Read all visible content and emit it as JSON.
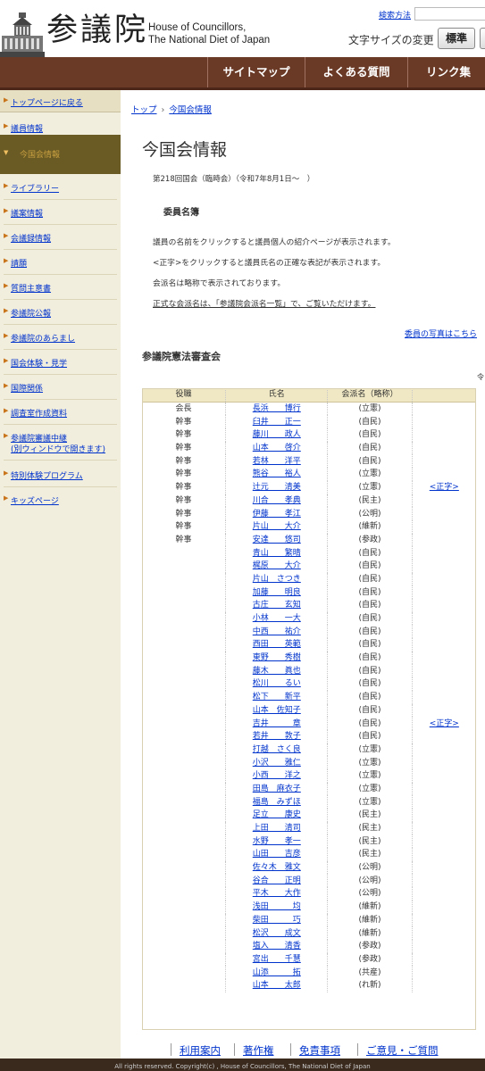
{
  "header": {
    "logo_text": "参議院",
    "name_en_1": "House of Councillors,",
    "name_en_2": "The National Diet of Japan",
    "search_link": "検索方法",
    "font_size_label": "文字サイズの変更",
    "font_size_standard": "標準"
  },
  "nav": [
    "サイトマップ",
    "よくある質問",
    "リンク集"
  ],
  "sidebar": {
    "top_link": "トップページに戻る",
    "items": [
      "議員情報",
      "今国会情報",
      "ライブラリー",
      "議案情報",
      "会議録情報",
      "請願",
      "質問主意書",
      "参議院公報",
      "参議院のあらまし",
      "国会体験・見学",
      "国際関係",
      "調査室作成資料",
      "参議院審議中継",
      "(別ウィンドウで開きます)",
      "特別体験プログラム",
      "キッズページ"
    ]
  },
  "breadcrumb": {
    "home": "トップ",
    "current": "今国会情報"
  },
  "page_title": "今国会情報",
  "session": "第218回国会（臨時会）（令和7年8月1日～　）",
  "section_heading": "委員名簿",
  "paragraphs": [
    "議員の名前をクリックすると議員個人の紹介ページが表示されます。",
    "<正字>をクリックすると議員氏名の正確な表記が表示されます。",
    "会派名は略称で表示されております。"
  ],
  "official_link": "正式な会派名は、「参議院会派名一覧」で、ご覧いただけます。",
  "photo_link": "委員の写真はこちら",
  "committee_title": "参議院憲法審査会",
  "tiny_right": "令",
  "table": {
    "headers": [
      "役職",
      "氏名",
      "会派名（略称）",
      ""
    ],
    "rows": [
      [
        "会長",
        "長浜　　博行",
        "(立憲)",
        ""
      ],
      [
        "幹事",
        "臼井　　正一",
        "(自民)",
        ""
      ],
      [
        "幹事",
        "藤川　　政人",
        "(自民)",
        ""
      ],
      [
        "幹事",
        "山本　　啓介",
        "(自民)",
        ""
      ],
      [
        "幹事",
        "若林　　洋平",
        "(自民)",
        ""
      ],
      [
        "幹事",
        "熊谷　　裕人",
        "(立憲)",
        ""
      ],
      [
        "幹事",
        "辻元　　清美",
        "(立憲)",
        "<正字>"
      ],
      [
        "幹事",
        "川合　　孝典",
        "(民主)",
        ""
      ],
      [
        "幹事",
        "伊藤　　孝江",
        "(公明)",
        ""
      ],
      [
        "幹事",
        "片山　　大介",
        "(維新)",
        ""
      ],
      [
        "幹事",
        "安達　　悠司",
        "(参政)",
        ""
      ],
      [
        "",
        "青山　　繁晴",
        "(自民)",
        ""
      ],
      [
        "",
        "梶原　　大介",
        "(自民)",
        ""
      ],
      [
        "",
        "片山　さつき",
        "(自民)",
        ""
      ],
      [
        "",
        "加藤　　明良",
        "(自民)",
        ""
      ],
      [
        "",
        "古庄　　玄知",
        "(自民)",
        ""
      ],
      [
        "",
        "小林　　一大",
        "(自民)",
        ""
      ],
      [
        "",
        "中西　　祐介",
        "(自民)",
        ""
      ],
      [
        "",
        "西田　　英範",
        "(自民)",
        ""
      ],
      [
        "",
        "東野　　秀樹",
        "(自民)",
        ""
      ],
      [
        "",
        "藤木　　眞也",
        "(自民)",
        ""
      ],
      [
        "",
        "松川　　るい",
        "(自民)",
        ""
      ],
      [
        "",
        "松下　　新平",
        "(自民)",
        ""
      ],
      [
        "",
        "山本　佐知子",
        "(自民)",
        ""
      ],
      [
        "",
        "吉井　　　章",
        "(自民)",
        "<正字>"
      ],
      [
        "",
        "若井　　敦子",
        "(自民)",
        ""
      ],
      [
        "",
        "打越　さく良",
        "(立憲)",
        ""
      ],
      [
        "",
        "小沢　　雅仁",
        "(立憲)",
        ""
      ],
      [
        "",
        "小西　　洋之",
        "(立憲)",
        ""
      ],
      [
        "",
        "田島　麻衣子",
        "(立憲)",
        ""
      ],
      [
        "",
        "福島　みずほ",
        "(立憲)",
        ""
      ],
      [
        "",
        "足立　　康史",
        "(民主)",
        ""
      ],
      [
        "",
        "上田　　清司",
        "(民主)",
        ""
      ],
      [
        "",
        "水野　　孝一",
        "(民主)",
        ""
      ],
      [
        "",
        "山田　　吉彦",
        "(民主)",
        ""
      ],
      [
        "",
        "佐々木　雅文",
        "(公明)",
        ""
      ],
      [
        "",
        "谷合　　正明",
        "(公明)",
        ""
      ],
      [
        "",
        "平木　　大作",
        "(公明)",
        ""
      ],
      [
        "",
        "浅田　　　均",
        "(維新)",
        ""
      ],
      [
        "",
        "柴田　　　巧",
        "(維新)",
        ""
      ],
      [
        "",
        "松沢　　成文",
        "(維新)",
        ""
      ],
      [
        "",
        "塩入　　清香",
        "(参政)",
        ""
      ],
      [
        "",
        "宮出　　千慧",
        "(参政)",
        ""
      ],
      [
        "",
        "山添　　　拓",
        "(共産)",
        ""
      ],
      [
        "",
        "山本　　太郎",
        "(れ新)",
        ""
      ]
    ]
  },
  "footer": {
    "links": [
      "利用案内",
      "著作権",
      "免責事項",
      "ご意見・ご質問"
    ],
    "copyright": "All rights reserved. Copyright(c) , House of Councillors, The National Diet of Japan"
  }
}
